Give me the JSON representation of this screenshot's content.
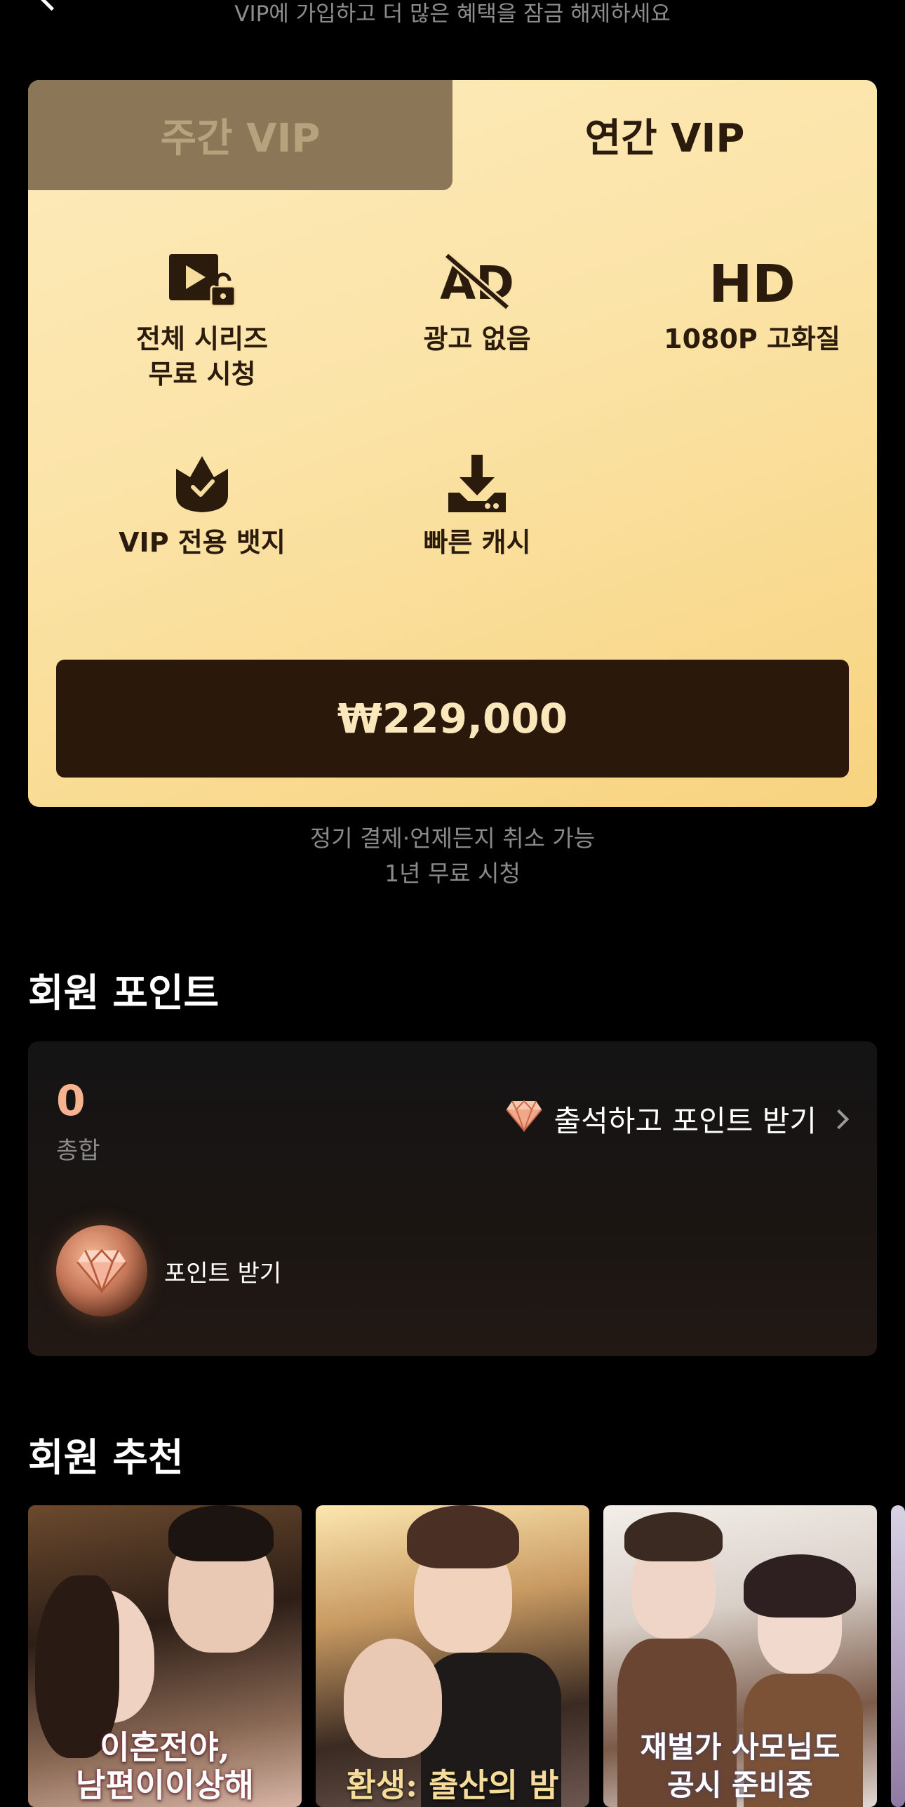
{
  "header": {
    "subtitle": "VIP에 가입하고 더 많은 혜택을 잠금 해제하세요"
  },
  "vip": {
    "tabs": [
      {
        "label": "주간 VIP",
        "selected": false
      },
      {
        "label": "연간 VIP",
        "selected": true
      }
    ],
    "benefits": [
      {
        "icon": "play-unlock-icon",
        "label": "전체 시리즈\n무료 시청"
      },
      {
        "icon": "no-ads-icon",
        "label": "광고 없음"
      },
      {
        "icon": "hd-icon",
        "label": "1080P 고화질"
      },
      {
        "icon": "vip-badge-icon",
        "label": "VIP 전용 뱃지"
      },
      {
        "icon": "download-icon",
        "label": "빠른 캐시"
      }
    ],
    "price_label": "₩229,000",
    "note_line1": "정기 결제·언제든지 취소 가능",
    "note_line2": "1년 무료 시청"
  },
  "points": {
    "section_title": "회원 포인트",
    "value": "0",
    "value_label": "총합",
    "attendance_label": "출석하고 포인트 받기",
    "get_points_label": "포인트 받기"
  },
  "recommendations": {
    "section_title": "회원 추천",
    "items": [
      {
        "title": "이혼전야,\n남편이이상해"
      },
      {
        "title": "환생: 출산의 밤"
      },
      {
        "title": "재벌가 사모님도\n공시 준비중"
      },
      {
        "title": ""
      }
    ]
  },
  "colors": {
    "accent_gold": "#f7d37f",
    "price_button": "#2a180a",
    "points_value": "#f7b28f"
  }
}
